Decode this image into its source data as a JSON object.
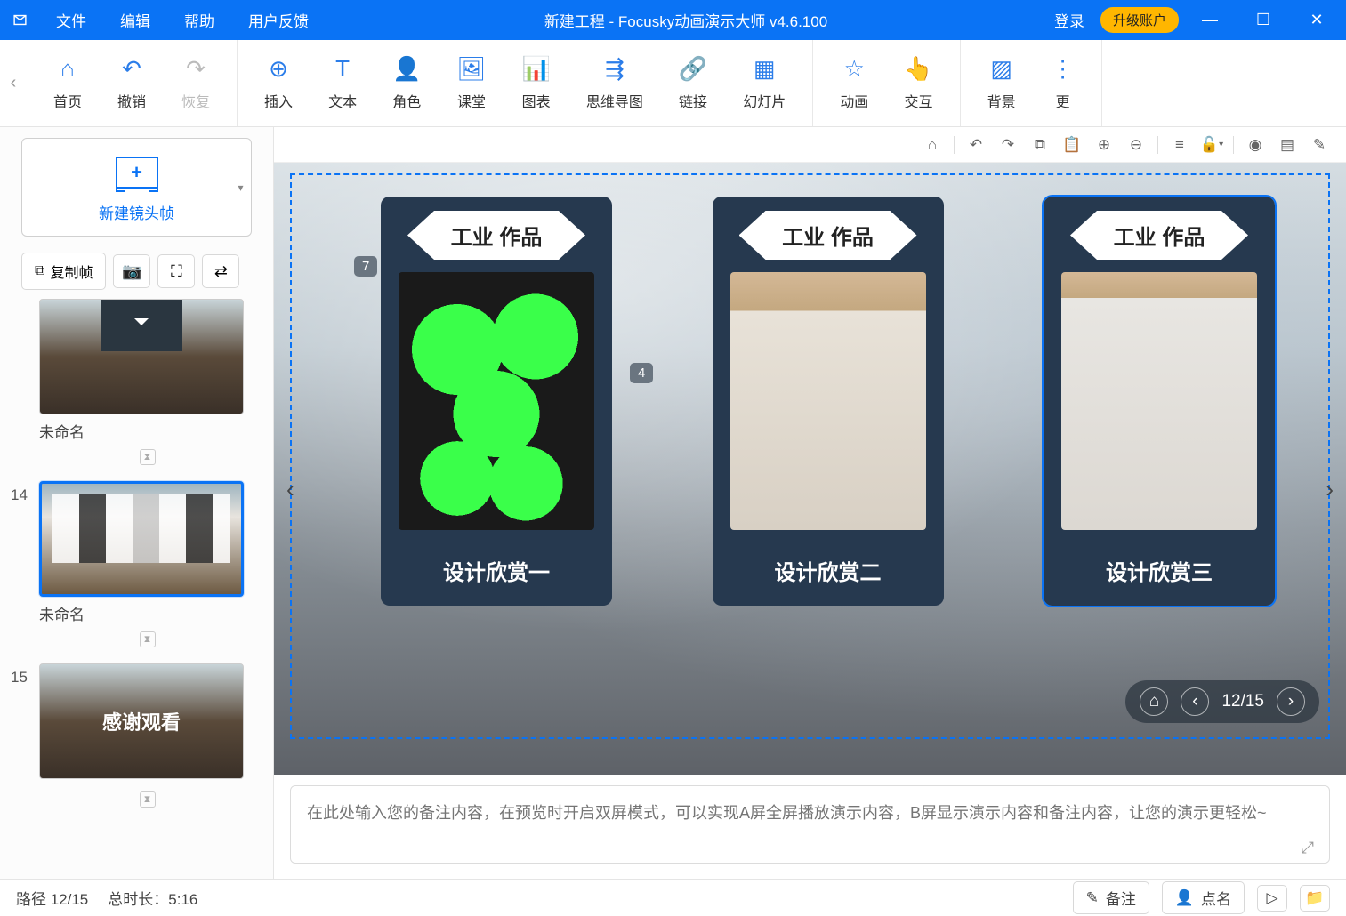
{
  "titlebar": {
    "menu": [
      "文件",
      "编辑",
      "帮助",
      "用户反馈"
    ],
    "title": "新建工程 - Focusky动画演示大师  v4.6.100",
    "login": "登录",
    "upgrade": "升级账户"
  },
  "toolbar": {
    "groups": [
      [
        {
          "icon": "home",
          "label": "首页"
        },
        {
          "icon": "undo",
          "label": "撤销"
        },
        {
          "icon": "redo",
          "label": "恢复",
          "disabled": true
        }
      ],
      [
        {
          "icon": "plus-circle",
          "label": "插入"
        },
        {
          "icon": "text",
          "label": "文本"
        },
        {
          "icon": "role",
          "label": "角色"
        },
        {
          "icon": "class",
          "label": "课堂"
        },
        {
          "icon": "chart",
          "label": "图表"
        },
        {
          "icon": "mindmap",
          "label": "思维导图"
        },
        {
          "icon": "link",
          "label": "链接"
        },
        {
          "icon": "slide",
          "label": "幻灯片"
        }
      ],
      [
        {
          "icon": "anim",
          "label": "动画"
        },
        {
          "icon": "interact",
          "label": "交互"
        }
      ],
      [
        {
          "icon": "bg",
          "label": "背景"
        },
        {
          "icon": "more",
          "label": "更"
        }
      ]
    ]
  },
  "sidebar": {
    "new_frame": "新建镜头帧",
    "copy_frame": "复制帧",
    "slides": [
      {
        "num": "",
        "name": "未命名",
        "type": "darkband"
      },
      {
        "num": "14",
        "name": "未命名",
        "type": "collage",
        "selected": true
      },
      {
        "num": "15",
        "name": "感谢观看",
        "type": "thanks"
      }
    ]
  },
  "canvas": {
    "frame_badges": [
      "7",
      "4"
    ],
    "cards": [
      {
        "title": "工业\n作品",
        "caption": "设计欣赏一"
      },
      {
        "title": "工业\n作品",
        "caption": "设计欣赏二"
      },
      {
        "title": "工业\n作品",
        "caption": "设计欣赏三"
      }
    ],
    "nav_counter": "12/15"
  },
  "notes_placeholder": "在此处输入您的备注内容，在预览时开启双屏模式，可以实现A屏全屏播放演示内容，B屏显示演示内容和备注内容，让您的演示更轻松~",
  "statusbar": {
    "path": "路径 12/15",
    "duration": "总时长：5:16",
    "notes_btn": "备注",
    "roll_btn": "点名"
  }
}
